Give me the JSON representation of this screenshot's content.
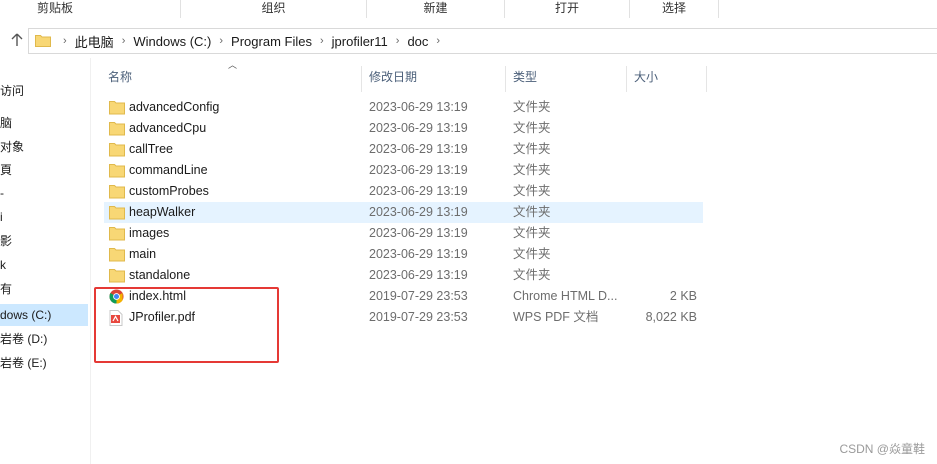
{
  "ribbon": {
    "groups": [
      "剪贴板",
      "组织",
      "新建",
      "打开",
      "选择"
    ]
  },
  "address": {
    "crumbs": [
      "此电脑",
      "Windows (C:)",
      "Program Files",
      "jprofiler11",
      "doc"
    ]
  },
  "navpane": {
    "items": [
      "访问",
      "脑",
      "对象",
      "頁",
      "-",
      "i",
      "影",
      "k",
      "有",
      "dows (C:)",
      "岩卷 (D:)",
      "岩卷 (E:)"
    ],
    "selected_index": 9
  },
  "columns": {
    "name": "名称",
    "date": "修改日期",
    "type": "类型",
    "size": "大小"
  },
  "files": [
    {
      "name": "advancedConfig",
      "date": "2023-06-29 13:19",
      "type": "文件夹",
      "size": "",
      "icon": "folder-icon"
    },
    {
      "name": "advancedCpu",
      "date": "2023-06-29 13:19",
      "type": "文件夹",
      "size": "",
      "icon": "folder-icon"
    },
    {
      "name": "callTree",
      "date": "2023-06-29 13:19",
      "type": "文件夹",
      "size": "",
      "icon": "folder-icon"
    },
    {
      "name": "commandLine",
      "date": "2023-06-29 13:19",
      "type": "文件夹",
      "size": "",
      "icon": "folder-icon"
    },
    {
      "name": "customProbes",
      "date": "2023-06-29 13:19",
      "type": "文件夹",
      "size": "",
      "icon": "folder-icon"
    },
    {
      "name": "heapWalker",
      "date": "2023-06-29 13:19",
      "type": "文件夹",
      "size": "",
      "icon": "folder-icon"
    },
    {
      "name": "images",
      "date": "2023-06-29 13:19",
      "type": "文件夹",
      "size": "",
      "icon": "folder-icon"
    },
    {
      "name": "main",
      "date": "2023-06-29 13:19",
      "type": "文件夹",
      "size": "",
      "icon": "folder-icon"
    },
    {
      "name": "standalone",
      "date": "2023-06-29 13:19",
      "type": "文件夹",
      "size": "",
      "icon": "folder-icon"
    },
    {
      "name": "index.html",
      "date": "2019-07-29 23:53",
      "type": "Chrome HTML D...",
      "size": "2 KB",
      "icon": "chrome-icon"
    },
    {
      "name": "JProfiler.pdf",
      "date": "2019-07-29 23:53",
      "type": "WPS PDF 文档",
      "size": "8,022 KB",
      "icon": "pdf-icon"
    }
  ],
  "hover_row_index": 5,
  "watermark": "CSDN @焱童鞋",
  "colors": {
    "folder": "#f8d775",
    "selected": "#cce8ff",
    "hover": "#e5f3ff",
    "annotation": "#e53935"
  }
}
